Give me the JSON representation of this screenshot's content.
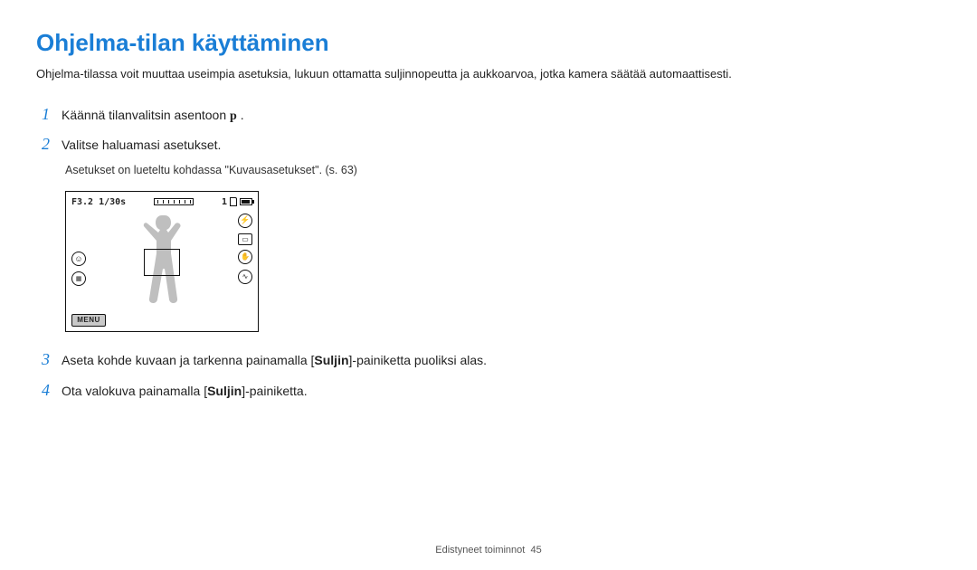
{
  "title": "Ohjelma-tilan käyttäminen",
  "intro": "Ohjelma-tilassa voit muuttaa useimpia asetuksia, lukuun ottamatta suljinnopeutta ja aukkoarvoa, jotka kamera säätää automaattisesti.",
  "steps": {
    "s1_num": "1",
    "s1_text_a": "Käännä tilanvalitsin asentoon ",
    "s1_text_p": "p",
    "s1_text_b": " .",
    "s2_num": "2",
    "s2_text": "Valitse haluamasi asetukset.",
    "s2_note": "Asetukset on lueteltu kohdassa \"Kuvausasetukset\". (s. 63)",
    "s3_num": "3",
    "s3_text_a": "Aseta kohde kuvaan ja tarkenna painamalla [",
    "s3_bold": "Suljin",
    "s3_text_b": "]-painiketta puoliksi alas.",
    "s4_num": "4",
    "s4_text_a": "Ota valokuva painamalla [",
    "s4_bold": "Suljin",
    "s4_text_b": "]-painiketta."
  },
  "camera": {
    "strip_left": "F3.2 1/30s",
    "strip_right_count": "1",
    "menu_label": "MENU"
  },
  "footer": {
    "label": "Edistyneet toiminnot",
    "page": "45"
  }
}
